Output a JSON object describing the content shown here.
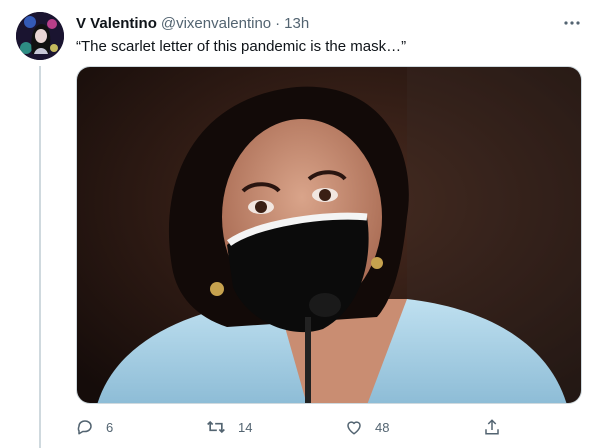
{
  "tweet": {
    "author": {
      "display_name": "V Valentino",
      "handle": "@vixenvalentino"
    },
    "separator": "·",
    "timestamp": "13h",
    "text": "“The scarlet letter of this pandemic is the mask…”"
  },
  "actions": {
    "reply_count": "6",
    "retweet_count": "14",
    "like_count": "48"
  },
  "icons": [
    "more-icon",
    "reply-icon",
    "retweet-icon",
    "like-icon",
    "share-icon"
  ],
  "colors": {
    "text_primary": "#0f1419",
    "text_secondary": "#536471",
    "border": "#cfd9de"
  }
}
